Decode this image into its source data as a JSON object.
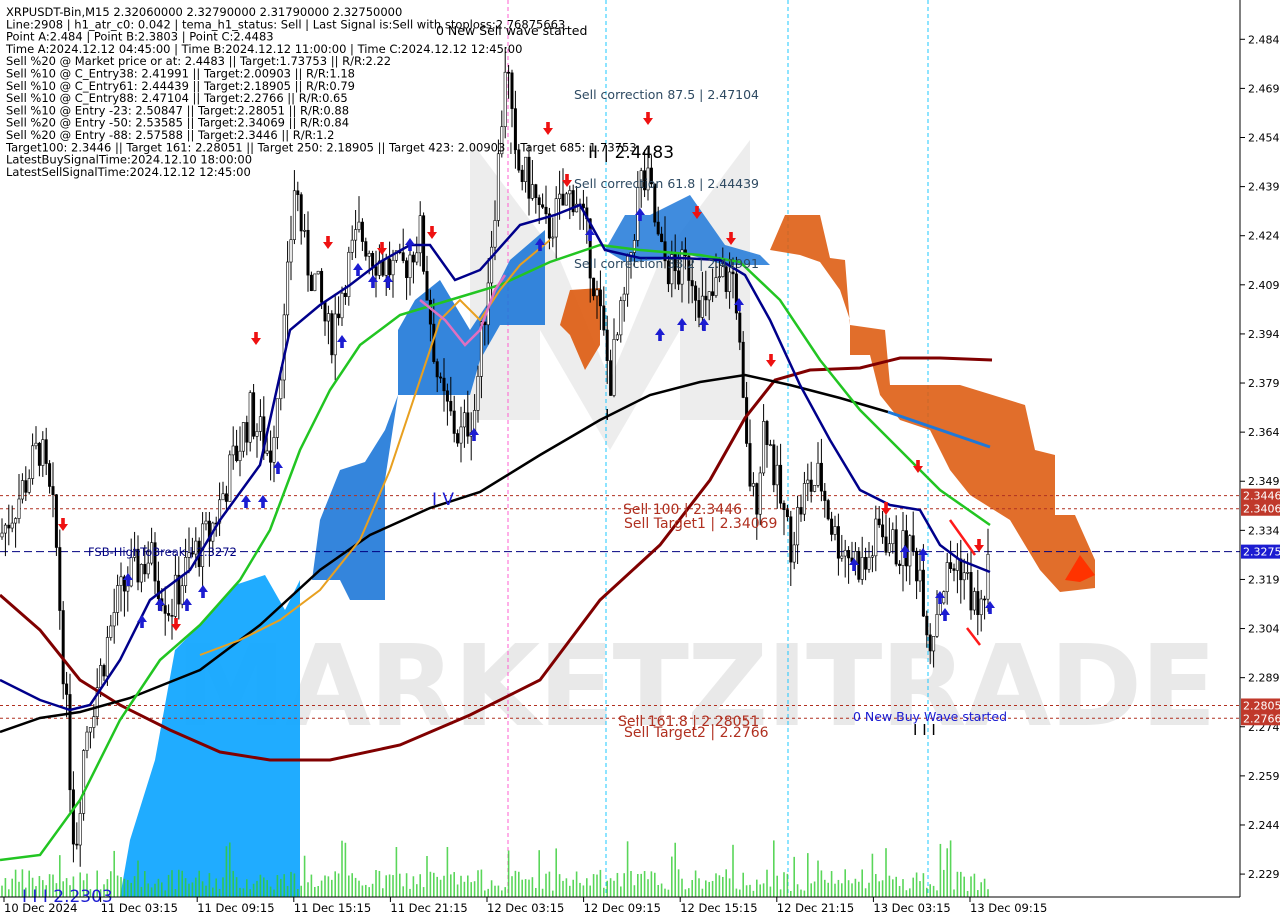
{
  "header": {
    "lines": [
      "XRPUSDT-Bin,M15  2.32060000 2.32790000 2.31790000 2.32750000",
      "Line:2908 | h1_atr_c0: 0.042 | tema_h1_status: Sell | Last Signal is:Sell with stoploss:2.76875663",
      "Point A:2.484 | Point B:2.3803 | Point C:2.4483",
      "Time A:2024.12.12 04:45:00 | Time B:2024.12.12 11:00:00 | Time C:2024.12.12 12:45:00",
      "Sell %20 @ Market price or at: 2.4483 || Target:1.73753 || R/R:2.22",
      "Sell %10 @ C_Entry38: 2.41991 || Target:2.00903 || R/R:1.18",
      "Sell %10 @ C_Entry61: 2.44439 || Target:2.18905 || R/R:0.79",
      "Sell %10 @ C_Entry88: 2.47104 || Target:2.2766 || R/R:0.65",
      "Sell %10 @ Entry -23: 2.50847 || Target:2.28051 || R/R:0.88",
      "Sell %20 @ Entry -50: 2.53585 || Target:2.34069 || R/R:0.84",
      "Sell %20 @ Entry -88: 2.57588 || Target:2.3446 || R/R:1.2",
      "Target100: 2.3446 || Target 161: 2.28051 || Target 250: 2.18905 || Target 423: 2.00903 || Target 685: 1.73753",
      "LatestBuySignalTime:2024.12.10 18:00:00",
      "LatestSellSignalTime:2024.12.12 12:45:00"
    ]
  },
  "watermark": "MARKETZITRADE",
  "annotations": {
    "new_sell_wave": "0 New Sell wave started",
    "sell_correction_875": "Sell correction 87.5 | 2.47104",
    "sell_correction_618": "Sell correction 61.8 | 2.44439",
    "sell_correction_382": "Sell correction 38.2 | 2.41991",
    "point_c_label": "II | 2.4483",
    "sell_100": "Sell 100 | 2.3446",
    "sell_target1": "Sell Target1 | 2.34069",
    "sell_1618": "Sell 161.8 | 2.28051",
    "sell_target2": "Sell Target2 | 2.2766",
    "new_buy_wave": "0 New Buy Wave started",
    "fsb": "FSB-HighToBreak | 2.3272",
    "wave_iv": "I V",
    "wave_iii": "I I I",
    "low_label": "I I I 2.2303",
    "wave_i": "I"
  },
  "colors": {
    "background": "#ffffff",
    "price_line": "#000080",
    "price_tag_bg": "#1c1cd1",
    "level_tag_bg": "#c0392b",
    "ema_green": "#22c522",
    "ema_navy": "#00008b",
    "ema_black": "#000000",
    "ema_maroon": "#800000",
    "cloud_blue": "#1e78d8",
    "cloud_lightblue": "#14a8ff",
    "cloud_orange": "#dd5a0e",
    "candle": "#000000",
    "volume": "#32cd32"
  },
  "chart_data": {
    "type": "candlestick",
    "symbol": "XRPUSDT-Bin",
    "timeframe": "M15",
    "ohlc_last": {
      "open": 2.3206,
      "high": 2.3279,
      "low": 2.3179,
      "close": 2.3275
    },
    "ylim": [
      2.222,
      2.496
    ],
    "y_ticks": [
      "2.484",
      "2.469",
      "2.454",
      "2.439",
      "2.424",
      "2.409",
      "2.394",
      "2.379",
      "2.364",
      "2.349",
      "2.334",
      "2.319",
      "2.304",
      "2.289",
      "2.274",
      "2.259",
      "2.244",
      "2.229"
    ],
    "x_ticks": [
      "10 Dec 2024",
      "11 Dec 03:15",
      "11 Dec 09:15",
      "11 Dec 15:15",
      "11 Dec 21:15",
      "12 Dec 03:15",
      "12 Dec 09:15",
      "12 Dec 15:15",
      "12 Dec 21:15",
      "13 Dec 03:15",
      "13 Dec 09:15"
    ],
    "price_levels": [
      {
        "label": "2.3446",
        "value": 2.3446,
        "kind": "sell"
      },
      {
        "label": "2.3406",
        "value": 2.3406,
        "kind": "sell"
      },
      {
        "label": "2.3275",
        "value": 2.3275,
        "kind": "current"
      },
      {
        "label": "2.2805",
        "value": 2.2805,
        "kind": "sell"
      },
      {
        "label": "2.2766",
        "value": 2.2766,
        "kind": "sell"
      }
    ],
    "price_path": [
      [
        0,
        2.332
      ],
      [
        20,
        2.345
      ],
      [
        40,
        2.36
      ],
      [
        55,
        2.335
      ],
      [
        65,
        2.285
      ],
      [
        75,
        2.235
      ],
      [
        85,
        2.272
      ],
      [
        100,
        2.29
      ],
      [
        115,
        2.31
      ],
      [
        130,
        2.32
      ],
      [
        150,
        2.326
      ],
      [
        170,
        2.31
      ],
      [
        190,
        2.325
      ],
      [
        210,
        2.333
      ],
      [
        230,
        2.352
      ],
      [
        250,
        2.37
      ],
      [
        270,
        2.357
      ],
      [
        285,
        2.398
      ],
      [
        295,
        2.442
      ],
      [
        305,
        2.418
      ],
      [
        315,
        2.41
      ],
      [
        330,
        2.392
      ],
      [
        345,
        2.412
      ],
      [
        360,
        2.425
      ],
      [
        380,
        2.416
      ],
      [
        400,
        2.412
      ],
      [
        420,
        2.425
      ],
      [
        440,
        2.375
      ],
      [
        460,
        2.362
      ],
      [
        475,
        2.372
      ],
      [
        490,
        2.418
      ],
      [
        500,
        2.452
      ],
      [
        506,
        2.481
      ],
      [
        515,
        2.445
      ],
      [
        530,
        2.44
      ],
      [
        545,
        2.425
      ],
      [
        560,
        2.432
      ],
      [
        575,
        2.438
      ],
      [
        590,
        2.418
      ],
      [
        610,
        2.38
      ],
      [
        625,
        2.405
      ],
      [
        640,
        2.441
      ],
      [
        650,
        2.438
      ],
      [
        660,
        2.418
      ],
      [
        675,
        2.412
      ],
      [
        690,
        2.415
      ],
      [
        705,
        2.4
      ],
      [
        720,
        2.41
      ],
      [
        735,
        2.412
      ],
      [
        745,
        2.36
      ],
      [
        755,
        2.34
      ],
      [
        765,
        2.37
      ],
      [
        775,
        2.35
      ],
      [
        790,
        2.33
      ],
      [
        805,
        2.346
      ],
      [
        820,
        2.35
      ],
      [
        835,
        2.332
      ],
      [
        850,
        2.327
      ],
      [
        865,
        2.322
      ],
      [
        880,
        2.335
      ],
      [
        895,
        2.328
      ],
      [
        910,
        2.328
      ],
      [
        920,
        2.322
      ],
      [
        930,
        2.3
      ],
      [
        940,
        2.315
      ],
      [
        950,
        2.322
      ],
      [
        960,
        2.325
      ],
      [
        970,
        2.315
      ],
      [
        980,
        2.307
      ],
      [
        990,
        2.3275
      ]
    ]
  }
}
